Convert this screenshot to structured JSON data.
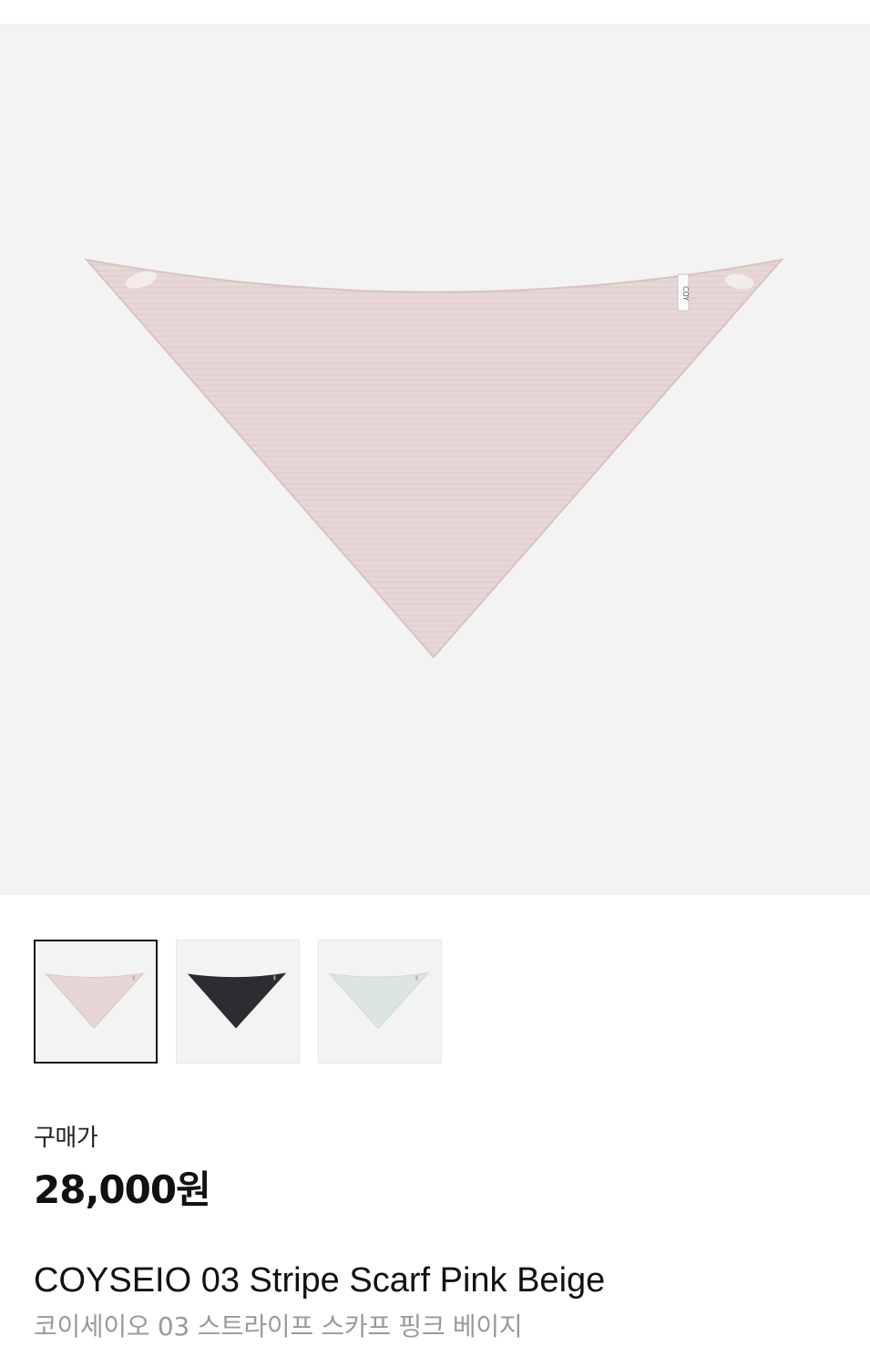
{
  "product": {
    "brand_tag": "COY",
    "price_label": "구매가",
    "price": "28,000원",
    "name_en": "COYSEIO 03 Stripe Scarf Pink Beige",
    "name_ko": "코이세이오 03 스트라이프 스카프 핑크 베이지",
    "main_image": {
      "icon": "scarf-image",
      "color": "#e6d6d5"
    }
  },
  "thumbnails": [
    {
      "color": "#e6d6d5",
      "selected": true,
      "icon": "scarf-thumbnail-pink-beige"
    },
    {
      "color": "#2b2d31",
      "selected": false,
      "icon": "scarf-thumbnail-black"
    },
    {
      "color": "#dbe5e3",
      "selected": false,
      "icon": "scarf-thumbnail-mint"
    }
  ],
  "colors": {
    "background": "#ffffff",
    "image_background": "#f3f3f3",
    "text_primary": "#111111",
    "text_secondary": "#9a9a9a"
  }
}
